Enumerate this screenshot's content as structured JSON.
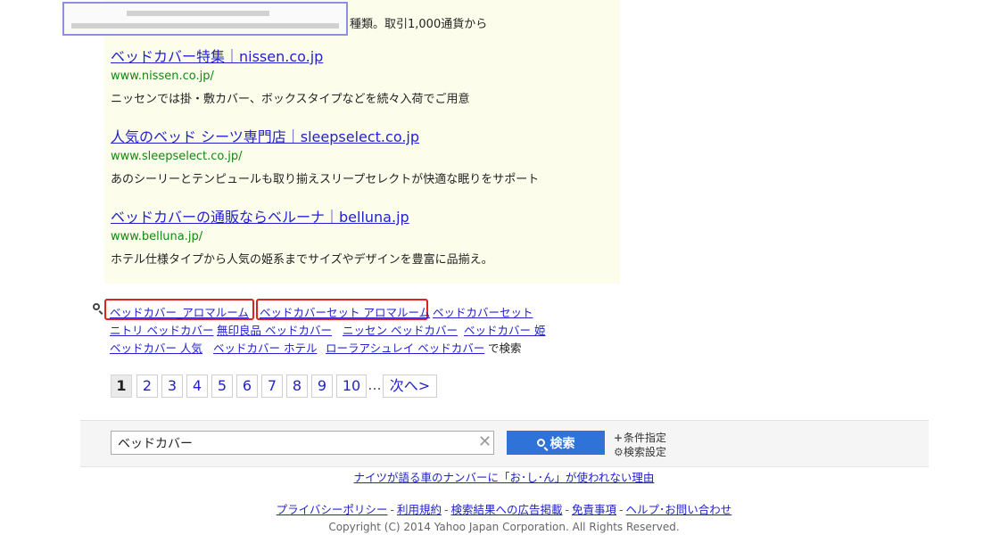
{
  "ads": {
    "first_ad_tail": "種類。取引1,000通貨から",
    "items": [
      {
        "title": "ベッドカバー特集｜nissen.co.jp",
        "url": "www.nissen.co.jp/",
        "description": "ニッセンでは掛・敷カバー、ボックスタイプなどを続々入荷でご用意"
      },
      {
        "title": "人気のベッド シーツ専門店｜sleepselect.co.jp",
        "url": "www.sleepselect.co.jp/",
        "description": "あのシーリーとテンピュールも取り揃えスリープセレクトが快適な眠りをサポート"
      },
      {
        "title": "ベッドカバーの通販ならベルーナ｜belluna.jp",
        "url": "www.belluna.jp/",
        "description": "ホテル仕様タイプから人気の姫系までサイズやデザインを豊富に品揃え。"
      }
    ]
  },
  "related": {
    "row1": [
      "ベッドカバー_アロマルーム",
      "ベッドカバーセット アロマルーム",
      "ベッドカバーセット"
    ],
    "row2": [
      "ニトリ ベッドカバー",
      "無印良品 ベッドカバー",
      "ニッセン ベッドカバー",
      "ベッドカバー 姫"
    ],
    "row3": [
      "ベッドカバー 人気",
      "ベッドカバー ホテル",
      "ローラアシュレイ ベッドカバー"
    ],
    "suffix": "で検索"
  },
  "pager": {
    "pages": [
      "1",
      "2",
      "3",
      "4",
      "5",
      "6",
      "7",
      "8",
      "9",
      "10"
    ],
    "ellipsis": "...",
    "next": "次へ>"
  },
  "search": {
    "value": "ベッドカバー",
    "button_label": "検索",
    "clear": "✕",
    "options": {
      "conditions": "条件指定",
      "settings": "検索設定"
    }
  },
  "promo": "ナイツが語る車のナンバーに「お･し･ん」が使われない理由",
  "footer": {
    "links": [
      "プライバシーポリシー",
      "利用規約",
      "検索結果への広告掲載",
      "免責事項",
      "ヘルプ･お問い合わせ"
    ],
    "separator": "-",
    "copyright": "Copyright (C) 2014 Yahoo Japan Corporation. All Rights Reserved."
  }
}
